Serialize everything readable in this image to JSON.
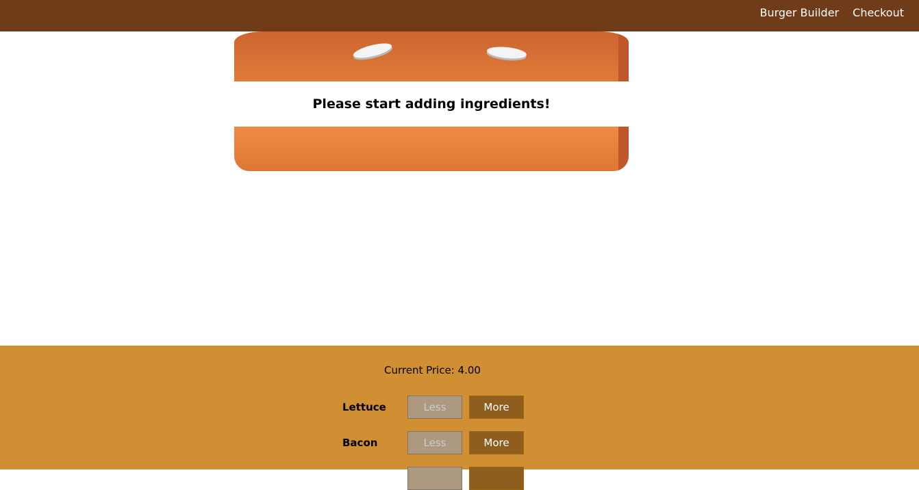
{
  "toolbar": {
    "nav": {
      "burger_builder": "Burger Builder",
      "checkout": "Checkout"
    }
  },
  "burger": {
    "message": "Please start adding ingredients!"
  },
  "controls": {
    "price_label": "Current Price:",
    "price_value": "4.00",
    "less_label": "Less",
    "more_label": "More",
    "ingredients": [
      {
        "label": "Lettuce"
      },
      {
        "label": "Bacon"
      }
    ]
  },
  "colors": {
    "toolbar": "#703b18",
    "controls_bg": "#cf8f32",
    "bun": "#e07a38",
    "more_button": "#8f5e1e",
    "less_button_disabled": "#ac9980"
  }
}
